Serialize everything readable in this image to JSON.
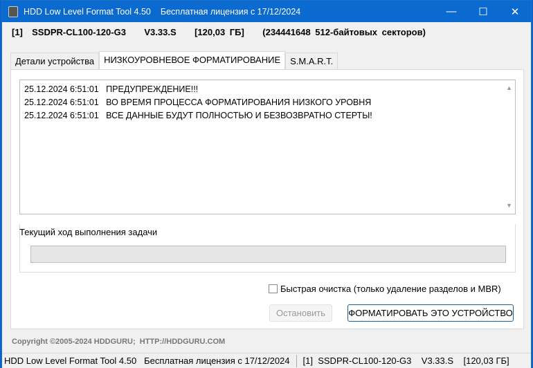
{
  "title": {
    "app": "HDD Low Level Format Tool 4.50",
    "license": "Бесплатная лицензия с 17/12/2024"
  },
  "window_controls": {
    "minimize": "—",
    "maximize": "☐",
    "close": "✕"
  },
  "device_line": "[1]  SSDPR-CL100-120-G3    V3.33.S    [120,03 ГБ]    (234441648 512-байтовых секторов)",
  "tabs": [
    {
      "label": "Детали устройства"
    },
    {
      "label": "НИЗКОУРОВНЕВОЕ ФОРМАТИРОВАНИЕ"
    },
    {
      "label": "S.M.A.R.T."
    }
  ],
  "log": [
    "25.12.2024 6:51:01   ПРЕДУПРЕЖДЕНИЕ!!!",
    "25.12.2024 6:51:01   ВО ВРЕМЯ ПРОЦЕССА ФОРМАТИРОВАНИЯ НИЗКОГО УРОВНЯ",
    "25.12.2024 6:51:01   ВСЕ ДАННЫЕ БУДУТ ПОЛНОСТЬЮ И БЕЗВОЗВРАТНО СТЕРТЫ!"
  ],
  "progress": {
    "label": "Текущий ход выполнения задачи",
    "value": 0
  },
  "quick_wipe": {
    "label": "Быстрая очистка (только удаление разделов и MBR)",
    "checked": false
  },
  "buttons": {
    "stop": "Остановить",
    "format": "ФОРМАТИРОВАТЬ ЭТО УСТРОЙСТВО"
  },
  "copyright": "Copyright ©2005-2024 HDDGURU;  HTTP://HDDGURU.COM",
  "status": {
    "left": "HDD Low Level Format Tool 4.50   Бесплатная лицензия с 17/12/2024",
    "right": "[1]  SSDPR-CL100-120-G3    V3.33.S    [120,03 ГБ]"
  }
}
